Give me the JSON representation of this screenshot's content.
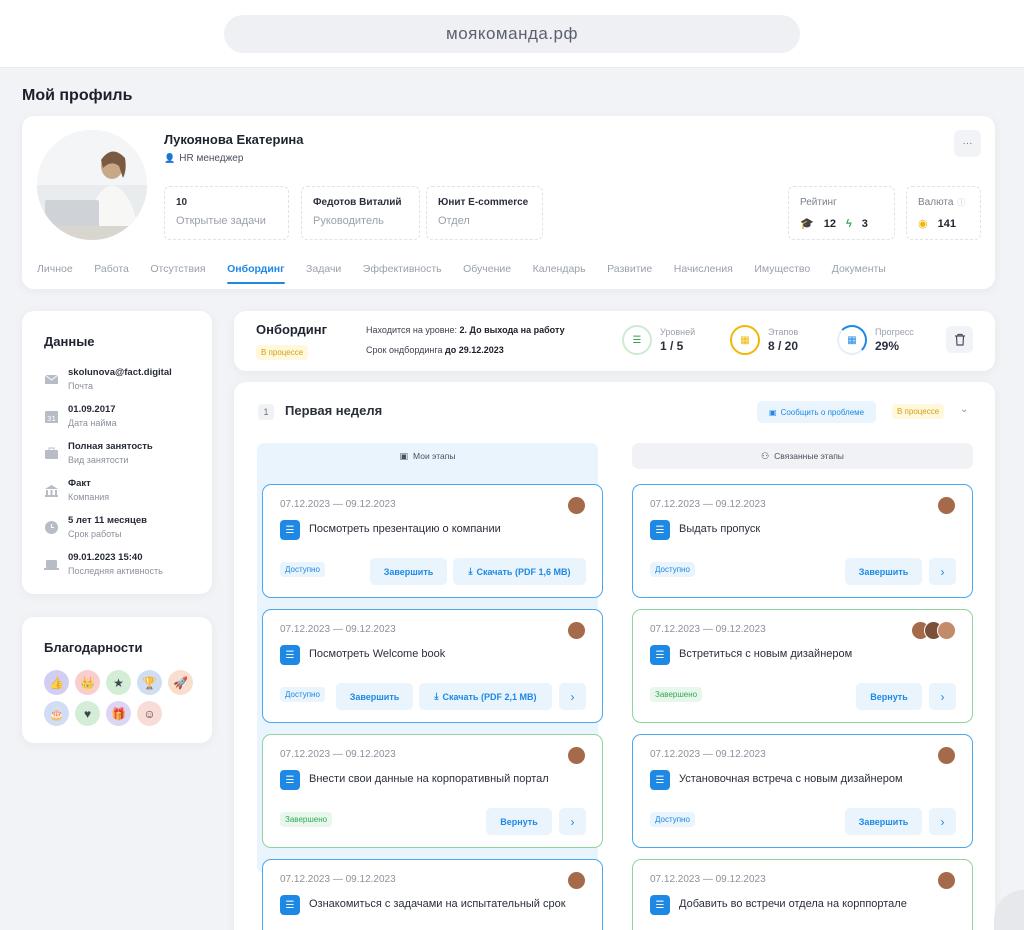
{
  "browser": {
    "url": "моякоманда.рф"
  },
  "page_title": "Мой профиль",
  "profile": {
    "name": "Лукоянова Екатерина",
    "role": "HR менеджер",
    "boxes": [
      {
        "value": "10",
        "label": "Открытые задачи"
      },
      {
        "value": "Федотов Виталий",
        "label": "Руководитель"
      },
      {
        "value": "Юнит E-commerce",
        "label": "Отдел"
      }
    ],
    "rating": {
      "label": "Рейтинг",
      "a": "12",
      "b": "3"
    },
    "currency": {
      "label": "Валюта",
      "value": "141"
    },
    "more": "···",
    "tabs": [
      "Личное",
      "Работа",
      "Отсутствия",
      "Онбординг",
      "Задачи",
      "Эффективность",
      "Обучение",
      "Календарь",
      "Развитие",
      "Начисления",
      "Имущество",
      "Документы"
    ],
    "active_tab": "Онбординг"
  },
  "data_card": {
    "title": "Данные",
    "items": [
      {
        "icon": "mail-icon",
        "value": "skolunova@fact.digital",
        "label": "Почта"
      },
      {
        "icon": "calendar-icon",
        "value": "01.09.2017",
        "label": "Дата найма"
      },
      {
        "icon": "briefcase-icon",
        "value": "Полная занятость",
        "label": "Вид занятости"
      },
      {
        "icon": "building-icon",
        "value": "Факт",
        "label": "Компания"
      },
      {
        "icon": "clock-icon",
        "value": "5 лет 11 месяцев",
        "label": "Срок работы"
      },
      {
        "icon": "laptop-icon",
        "value": "09.01.2023 15:40",
        "label": "Последняя активность"
      }
    ]
  },
  "thanks": {
    "title": "Благодарности",
    "badges": [
      {
        "icon": "thumbs-up-icon",
        "color": "#c9c6f3",
        "glyph": "👍"
      },
      {
        "icon": "crown-icon",
        "color": "#f7c6c6",
        "glyph": "👑"
      },
      {
        "icon": "star-icon",
        "color": "#cdebcf",
        "glyph": "★"
      },
      {
        "icon": "trophy-icon",
        "color": "#c7d9f3",
        "glyph": "🏆"
      },
      {
        "icon": "rocket-icon",
        "color": "#f7d9c6",
        "glyph": "🚀"
      },
      {
        "icon": "cake-icon",
        "color": "#c7d9f3",
        "glyph": "🎂"
      },
      {
        "icon": "heart-icon",
        "color": "#cdebcf",
        "glyph": "♥"
      },
      {
        "icon": "gift-icon",
        "color": "#d6cff3",
        "glyph": "🎁"
      },
      {
        "icon": "smile-icon",
        "color": "#f7d6cf",
        "glyph": "☺"
      }
    ]
  },
  "onboarding": {
    "title": "Онбординг",
    "status": "В процессе",
    "level_label": "Находится на уровне:",
    "level_value": "2. До выхода на работу",
    "deadline_label": "Срок ондбординга",
    "deadline_value": "до 29.12.2023",
    "stats": [
      {
        "label": "Уровней",
        "value": "1 / 5",
        "color": "#34a853",
        "icon": "list-icon"
      },
      {
        "label": "Этапов",
        "value": "8 / 20",
        "color": "#f2b705",
        "icon": "grid-icon"
      },
      {
        "label": "Прогресс",
        "value": "29%",
        "color": "#1e88e5",
        "icon": "grid-icon",
        "progress": 0.29
      }
    ]
  },
  "week": {
    "number": "1",
    "title": "Первая неделя",
    "report_label": "Сообщить о проблеме",
    "status": "В процессе",
    "my_stages": "Мои этапы",
    "linked_stages": "Связанные этапы",
    "left_tasks": [
      {
        "dates": "07.12.2023 — 09.12.2023",
        "title": "Посмотреть презентацию о компании",
        "status": "Доступно",
        "done": false,
        "primary": "Завершить",
        "download": "Скачать (PDF 1,6 MB)",
        "arrow": false,
        "faces": 1
      },
      {
        "dates": "07.12.2023 — 09.12.2023",
        "title": "Посмотреть Welcome book",
        "status": "Доступно",
        "done": false,
        "primary": "Завершить",
        "download": "Скачать (PDF 2,1 MB)",
        "arrow": true,
        "faces": 1
      },
      {
        "dates": "07.12.2023 — 09.12.2023",
        "title": "Внести свои данные на корпоративный портал",
        "status": "Завершено",
        "done": true,
        "primary": "Вернуть",
        "download": "",
        "arrow": true,
        "faces": 1
      },
      {
        "dates": "07.12.2023 — 09.12.2023",
        "title": "Ознакомиться с задачами на испытательный срок",
        "status": "",
        "done": false,
        "primary": "",
        "download": "",
        "arrow": false,
        "faces": 1
      }
    ],
    "right_tasks": [
      {
        "dates": "07.12.2023 — 09.12.2023",
        "title": "Выдать пропуск",
        "status": "Доступно",
        "done": false,
        "primary": "Завершить",
        "arrow": true,
        "faces": 1
      },
      {
        "dates": "07.12.2023 — 09.12.2023",
        "title": "Встретиться с новым дизайнером",
        "status": "Завершено",
        "done": true,
        "primary": "Вернуть",
        "arrow": true,
        "faces": 3
      },
      {
        "dates": "07.12.2023 — 09.12.2023",
        "title": "Установочная встреча с новым дизайнером",
        "status": "Доступно",
        "done": false,
        "primary": "Завершить",
        "arrow": true,
        "faces": 1
      },
      {
        "dates": "07.12.2023 — 09.12.2023",
        "title": "Добавить во встречи отдела на корппортале",
        "status": "",
        "done": true,
        "primary": "",
        "arrow": false,
        "faces": 1
      }
    ]
  }
}
